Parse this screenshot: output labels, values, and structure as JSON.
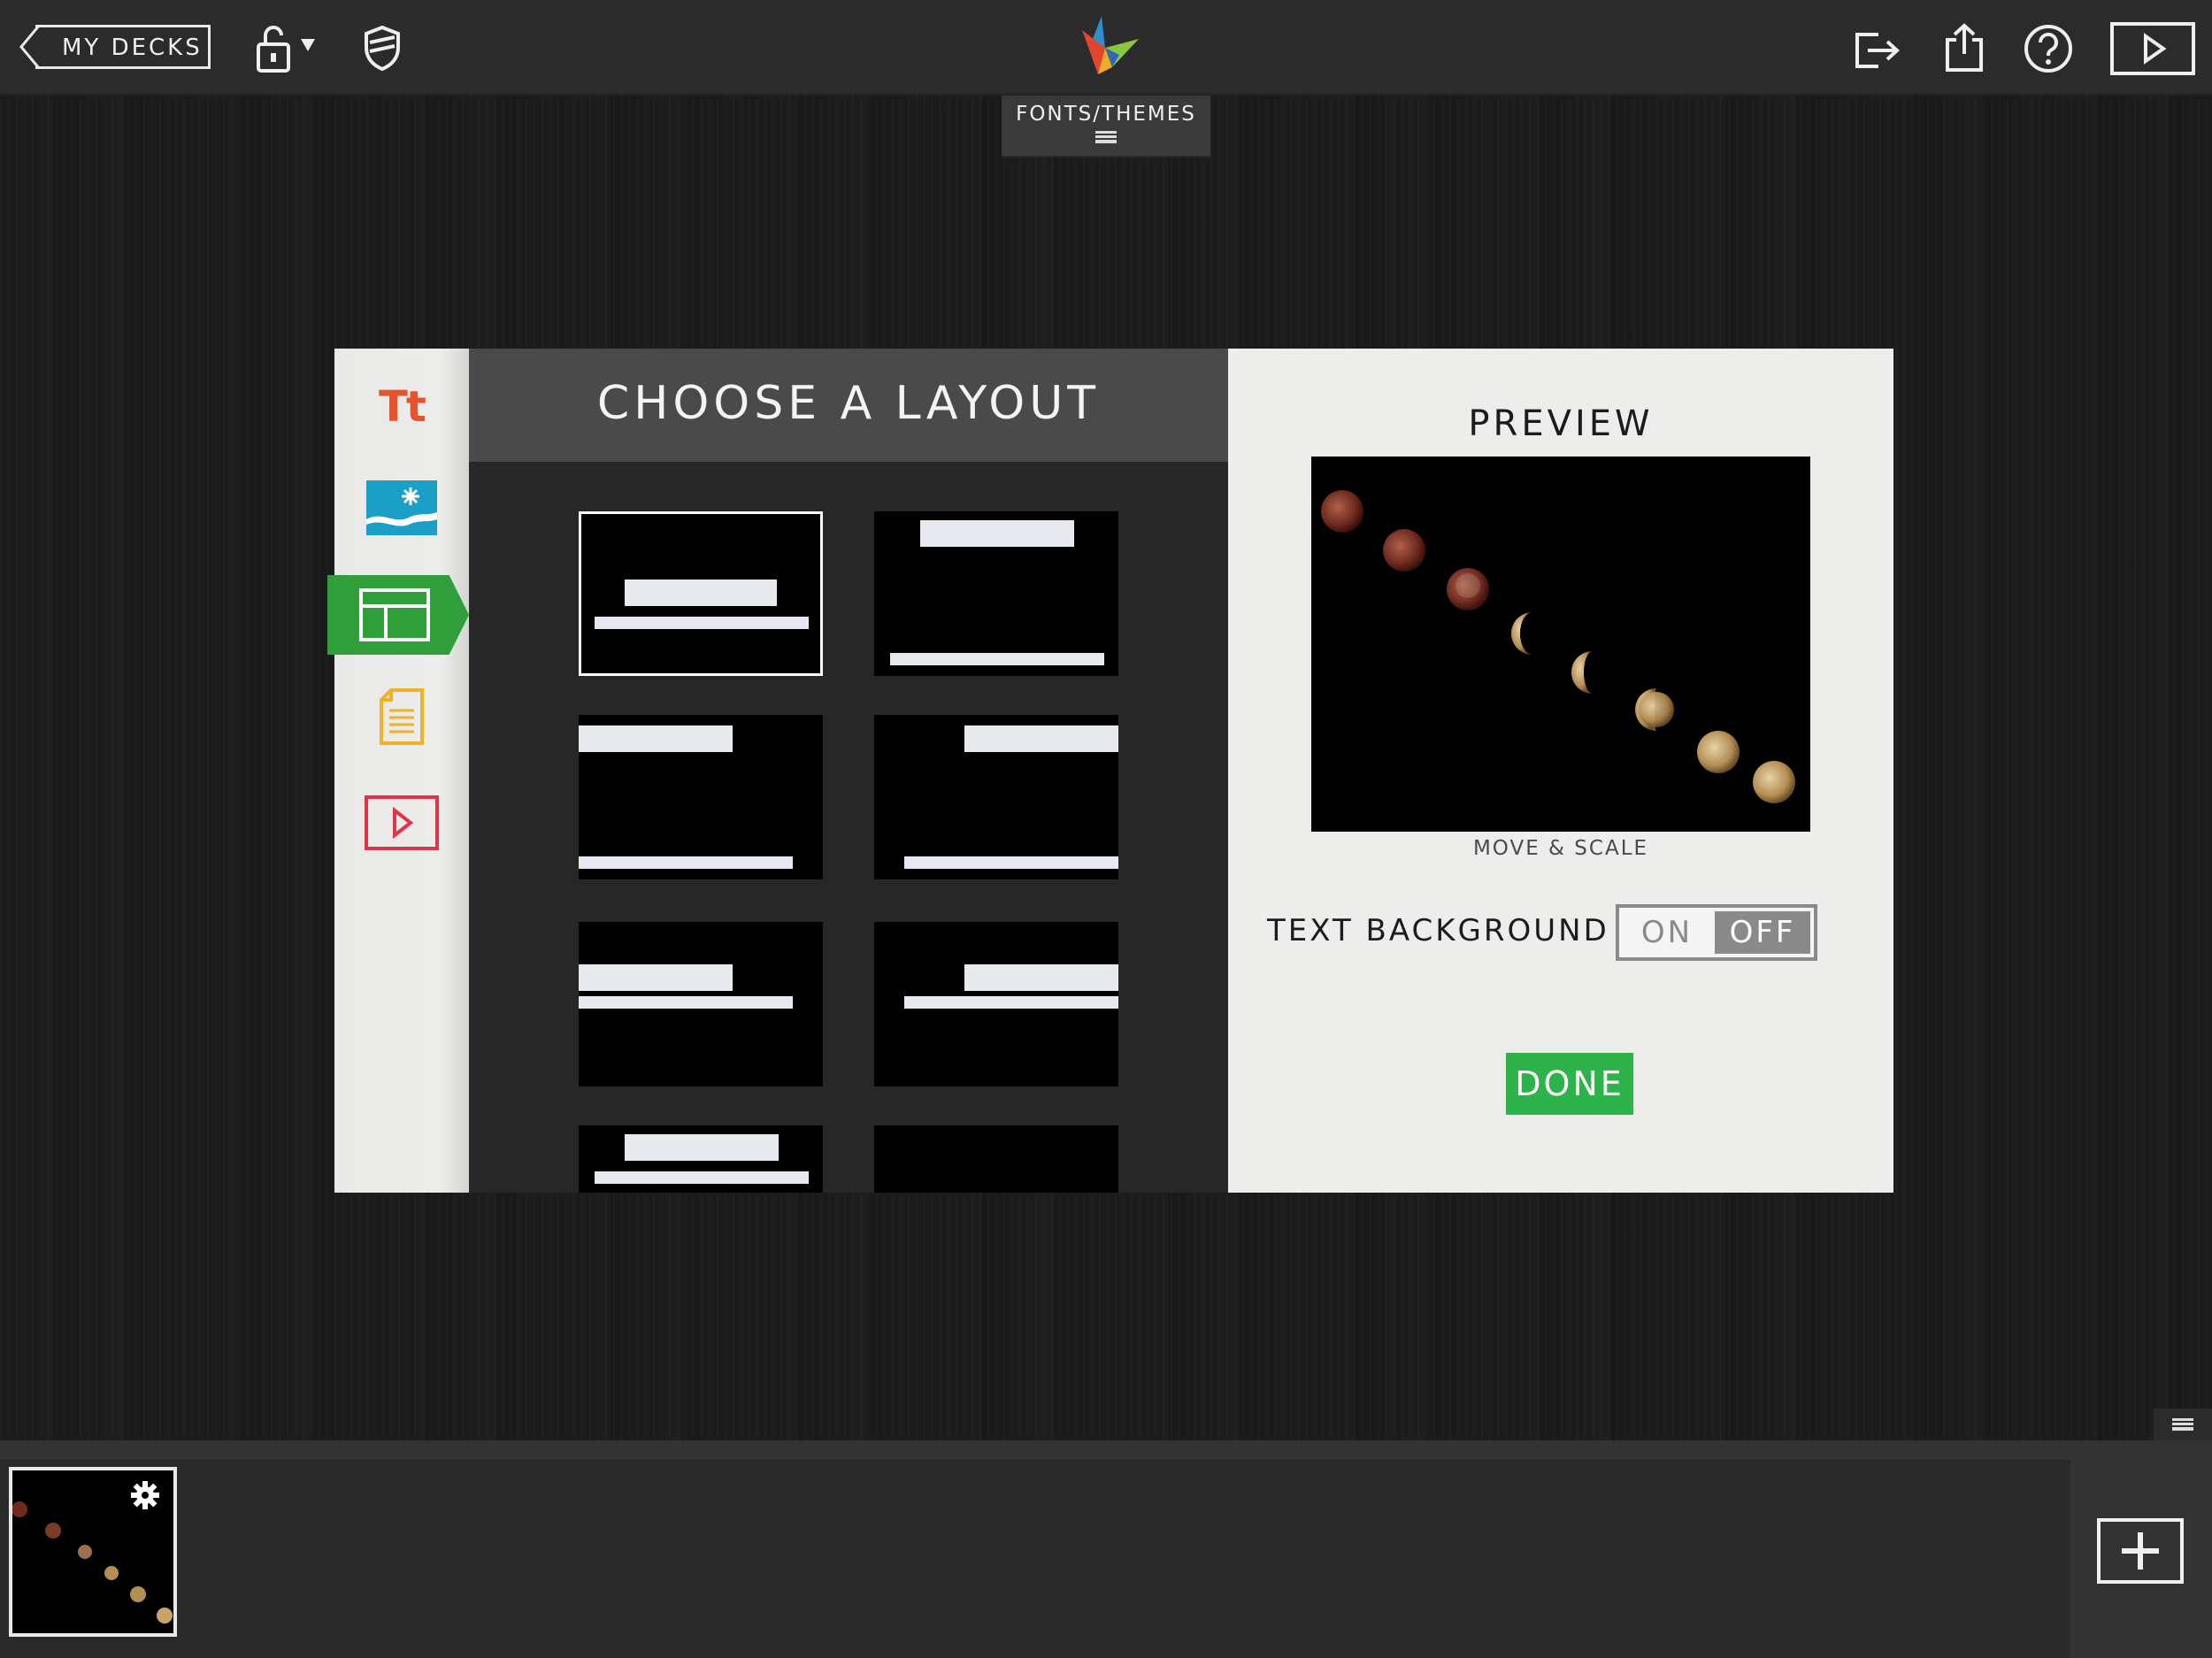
{
  "topbar": {
    "back_label": "MY DECKS",
    "fonts_tab_label": "FONTS/THEMES"
  },
  "sidebar": {
    "items": [
      {
        "name": "text",
        "icon": "text-tt-icon",
        "color": "#e8532f"
      },
      {
        "name": "image",
        "icon": "image-icon",
        "color": "#1c9fc7"
      },
      {
        "name": "layout",
        "icon": "layout-icon",
        "color": "#2f9e3b",
        "active": true
      },
      {
        "name": "notes",
        "icon": "document-icon",
        "color": "#f0b126"
      },
      {
        "name": "video",
        "icon": "play-icon",
        "color": "#e0344b"
      }
    ]
  },
  "layout_panel": {
    "title": "CHOOSE A LAYOUT",
    "selected_index": 0
  },
  "preview": {
    "title": "PREVIEW",
    "image_caption": "MOVE & SCALE",
    "text_background_label": "TEXT BACKGROUND",
    "toggle_on": "ON",
    "toggle_off": "OFF",
    "toggle_state": "OFF",
    "done_label": "DONE"
  },
  "colors": {
    "accent_green": "#2f9e3b",
    "done_green": "#2eb24a"
  }
}
